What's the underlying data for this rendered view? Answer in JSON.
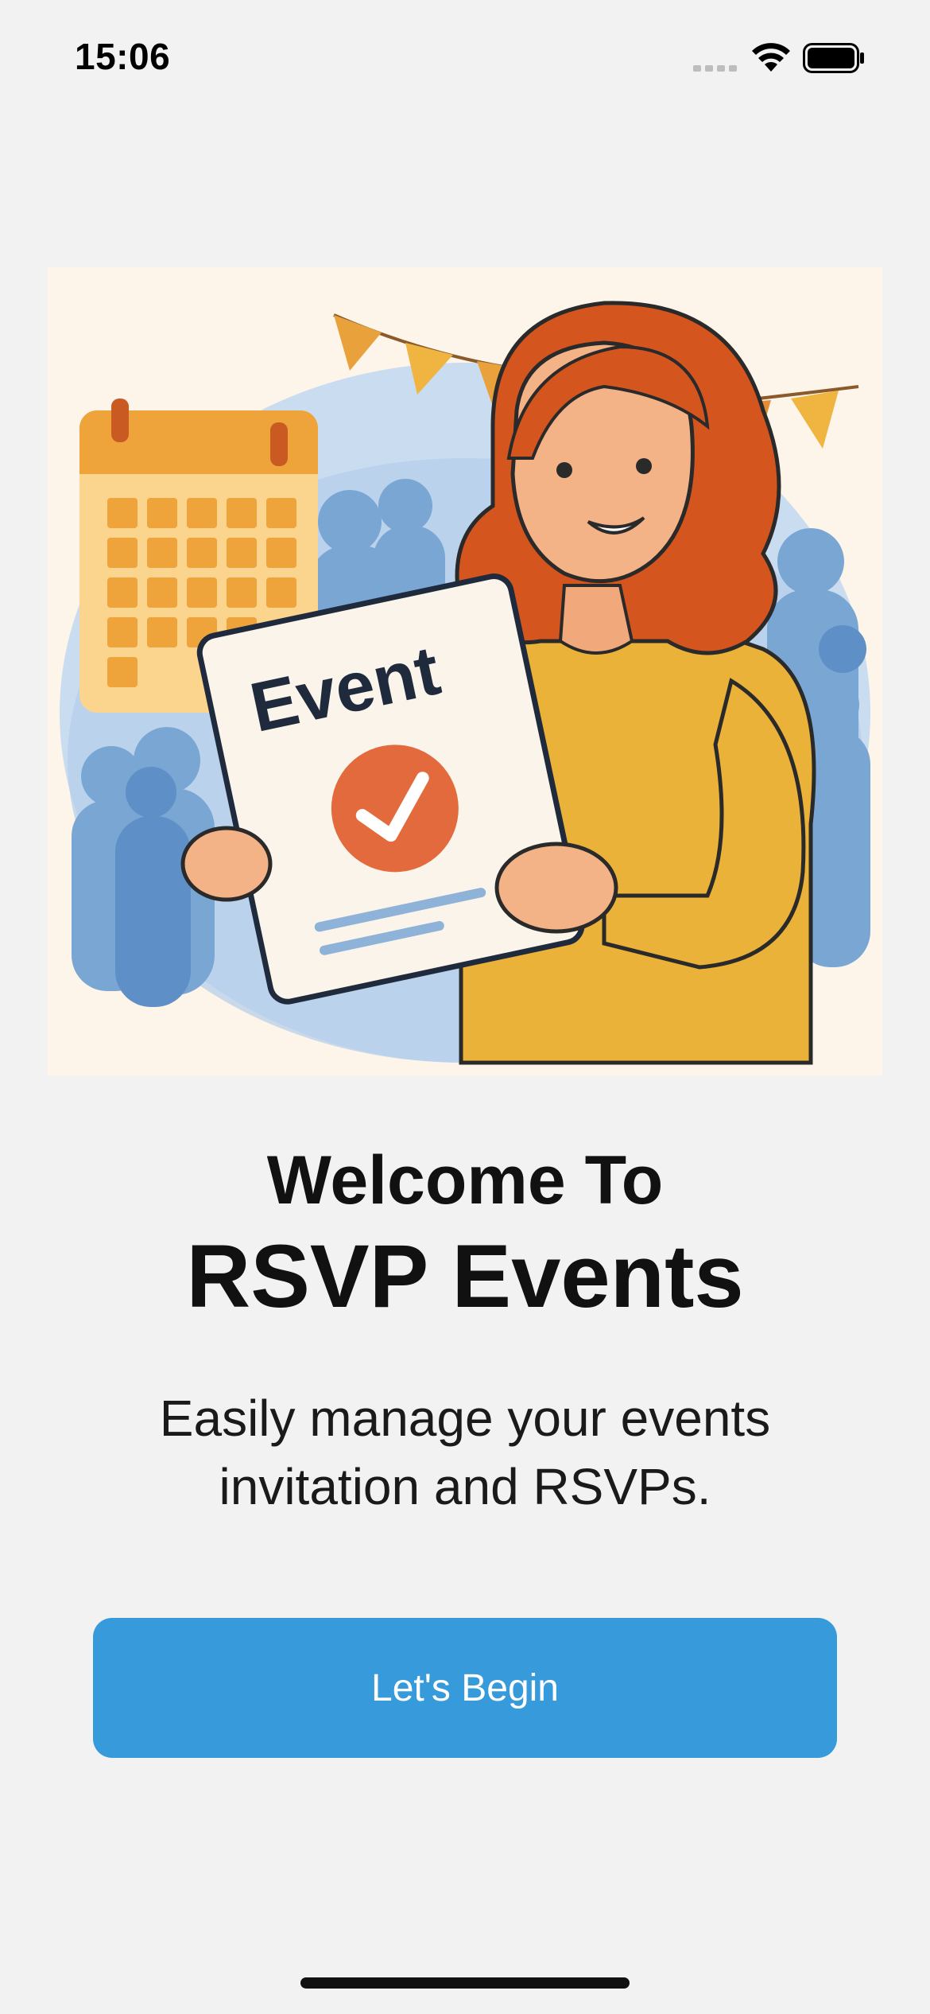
{
  "status_bar": {
    "time": "15:06",
    "icons": [
      "signal-icon",
      "wifi-icon",
      "battery-icon"
    ]
  },
  "illustration": {
    "description_icon": "event-rsvp-illustration",
    "card_text": "Event"
  },
  "welcome": {
    "line1": "Welcome To",
    "app_name": "RSVP Events",
    "description": "Easily manage your events invitation and RSVPs."
  },
  "actions": {
    "begin_label": "Let's Begin"
  },
  "colors": {
    "background": "#f2f2f2",
    "primary_button": "#379adb",
    "illustration_bg": "#fdf5ea",
    "hair": "#d4561e",
    "sweater": "#ebb23a",
    "check": "#e36a3c",
    "crowd": "#7aa6d4"
  }
}
